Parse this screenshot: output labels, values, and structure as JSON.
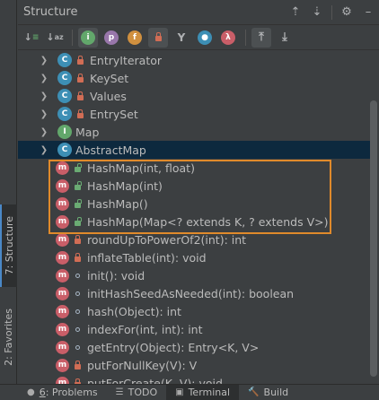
{
  "panel": {
    "title": "Structure"
  },
  "header_icons": [
    "expand-all-icon",
    "collapse-all-icon",
    "gear-icon",
    "hide-icon"
  ],
  "toolbar": {
    "buttons": [
      {
        "name": "sort-visibility-icon",
        "glyph": "↓ᵃ"
      },
      {
        "name": "sort-alpha-icon",
        "glyph": "↓ᵃᶻ"
      },
      {
        "name": "show-inherited-icon",
        "glyph": "i"
      },
      {
        "name": "show-properties-icon",
        "glyph": "p"
      },
      {
        "name": "show-fields-icon",
        "glyph": "f"
      },
      {
        "name": "show-non-public-icon",
        "glyph": ""
      },
      {
        "name": "show-anonymous-icon",
        "glyph": "Y"
      },
      {
        "name": "show-objects-icon",
        "glyph": ""
      },
      {
        "name": "show-lambdas-icon",
        "glyph": "λ"
      },
      {
        "name": "autoscroll-to-source-icon",
        "glyph": "⤒"
      },
      {
        "name": "autoscroll-from-source-icon",
        "glyph": "⤓"
      }
    ]
  },
  "tree": [
    {
      "kind": "class",
      "vis": "private",
      "label": "EntryIterator"
    },
    {
      "kind": "class",
      "vis": "private",
      "label": "KeySet"
    },
    {
      "kind": "class",
      "vis": "private",
      "label": "Values"
    },
    {
      "kind": "class",
      "vis": "private",
      "label": "EntrySet"
    },
    {
      "kind": "interface",
      "vis": "none",
      "label": "Map"
    },
    {
      "kind": "class",
      "vis": "none",
      "label": "AbstractMap",
      "selected": true
    },
    {
      "kind": "method",
      "vis": "public",
      "label": "HashMap(int, float)"
    },
    {
      "kind": "method",
      "vis": "public",
      "label": "HashMap(int)"
    },
    {
      "kind": "method",
      "vis": "public",
      "label": "HashMap()"
    },
    {
      "kind": "method",
      "vis": "public",
      "label": "HashMap(Map<? extends K, ? extends V>)"
    },
    {
      "kind": "method",
      "vis": "private",
      "label": "roundUpToPowerOf2(int): int"
    },
    {
      "kind": "method",
      "vis": "private",
      "label": "inflateTable(int): void"
    },
    {
      "kind": "method",
      "vis": "package",
      "label": "init(): void"
    },
    {
      "kind": "method",
      "vis": "package",
      "label": "initHashSeedAsNeeded(int): boolean"
    },
    {
      "kind": "method",
      "vis": "package",
      "label": "hash(Object): int"
    },
    {
      "kind": "method",
      "vis": "package",
      "label": "indexFor(int, int): int"
    },
    {
      "kind": "method",
      "vis": "package",
      "label": "getEntry(Object): Entry<K, V>"
    },
    {
      "kind": "method",
      "vis": "private",
      "label": "putForNullKey(V): V"
    },
    {
      "kind": "method",
      "vis": "private",
      "label": "putForCreate(K, V): void"
    }
  ],
  "left_tabs": {
    "structure": {
      "number": "7",
      "label": "7: Structure"
    },
    "favorites": {
      "number": "2",
      "label": "2: Favorites"
    }
  },
  "bottom_tabs": [
    {
      "name": "problems",
      "num": "6",
      "label": ": Problems",
      "icon": "problems-icon",
      "glyph": "●"
    },
    {
      "name": "todo",
      "num": "",
      "label": "TODO",
      "icon": "todo-icon",
      "glyph": "☰"
    },
    {
      "name": "terminal",
      "num": "",
      "label": "Terminal",
      "icon": "terminal-icon",
      "glyph": "▣",
      "active": true
    },
    {
      "name": "build",
      "num": "",
      "label": "Build",
      "icon": "build-icon",
      "glyph": "🔨"
    }
  ],
  "colors": {
    "selection": "#0d293e",
    "highlight_border": "#e08a2b",
    "class_icon": "#3d8fb5",
    "method_icon": "#c95e68",
    "interface_icon": "#62a76b"
  }
}
